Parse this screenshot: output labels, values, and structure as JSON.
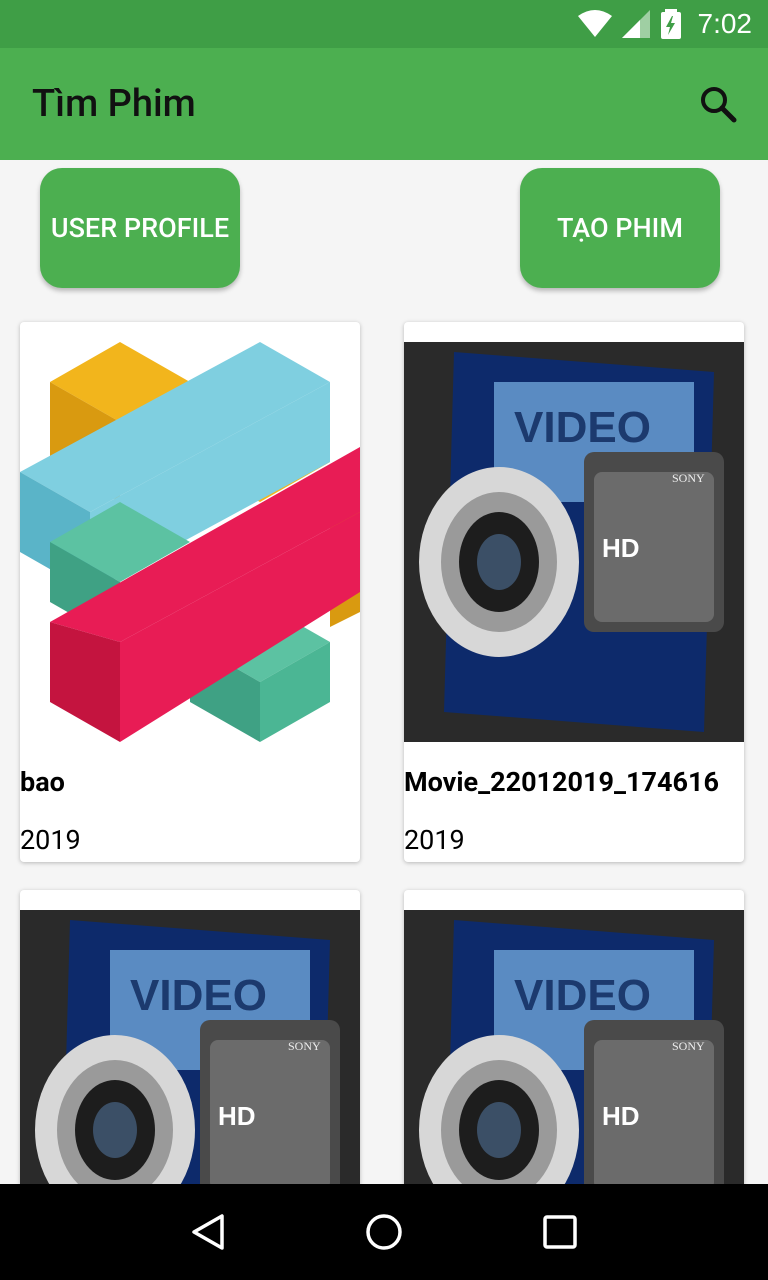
{
  "status_bar": {
    "time": "7:02",
    "icons": [
      "wifi-icon",
      "cell-signal-icon",
      "battery-charging-icon"
    ]
  },
  "app_bar": {
    "title": "Tìm Phim",
    "search_icon": "search-icon"
  },
  "actions": {
    "user_profile": "USER PROFILE",
    "create_movie": "TẠO PHIM"
  },
  "movies": [
    {
      "title": "bao",
      "year": "2019",
      "thumbnail": "abstract-blocks"
    },
    {
      "title": "Movie_22012019_174616",
      "year": "2019",
      "thumbnail": "video-camera"
    },
    {
      "title": "",
      "year": "",
      "thumbnail": "video-camera"
    },
    {
      "title": "",
      "year": "",
      "thumbnail": "video-camera"
    }
  ],
  "nav_bar": {
    "icons": [
      "back-icon",
      "home-icon",
      "recents-icon"
    ]
  },
  "colors": {
    "status_bar": "#3f9e46",
    "app_bar": "#4caf50",
    "button": "#4caf50",
    "background": "#f5f5f5"
  }
}
